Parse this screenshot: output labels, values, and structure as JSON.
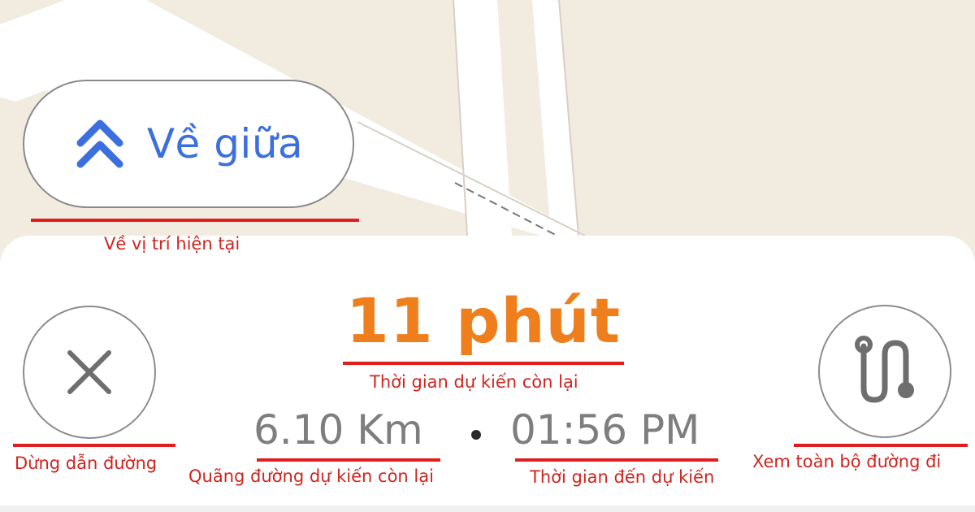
{
  "map": {
    "background_color": "#f2ebe0",
    "road_color": "#ffffff"
  },
  "recenter": {
    "label": "Về giữa",
    "icon": "double-chevron-up-icon",
    "color": "#3b6fe0"
  },
  "panel": {
    "eta_minutes": "11 phút",
    "distance": "6.10 Km",
    "separator": "•",
    "arrival_time": "01:56 PM",
    "stop_icon": "close-icon",
    "overview_icon": "route-overview-icon",
    "eta_color": "#ef7e1c"
  },
  "annotations": {
    "recenter": "Về vị trí hiện tại",
    "eta": "Thời gian dự kiến còn lại",
    "stop": "Dừng dẫn đường",
    "distance": "Quãng đường dự kiến còn lại",
    "arrival": "Thời gian đến dự kiến",
    "overview": "Xem toàn bộ đường đi",
    "color": "#d0241d"
  }
}
